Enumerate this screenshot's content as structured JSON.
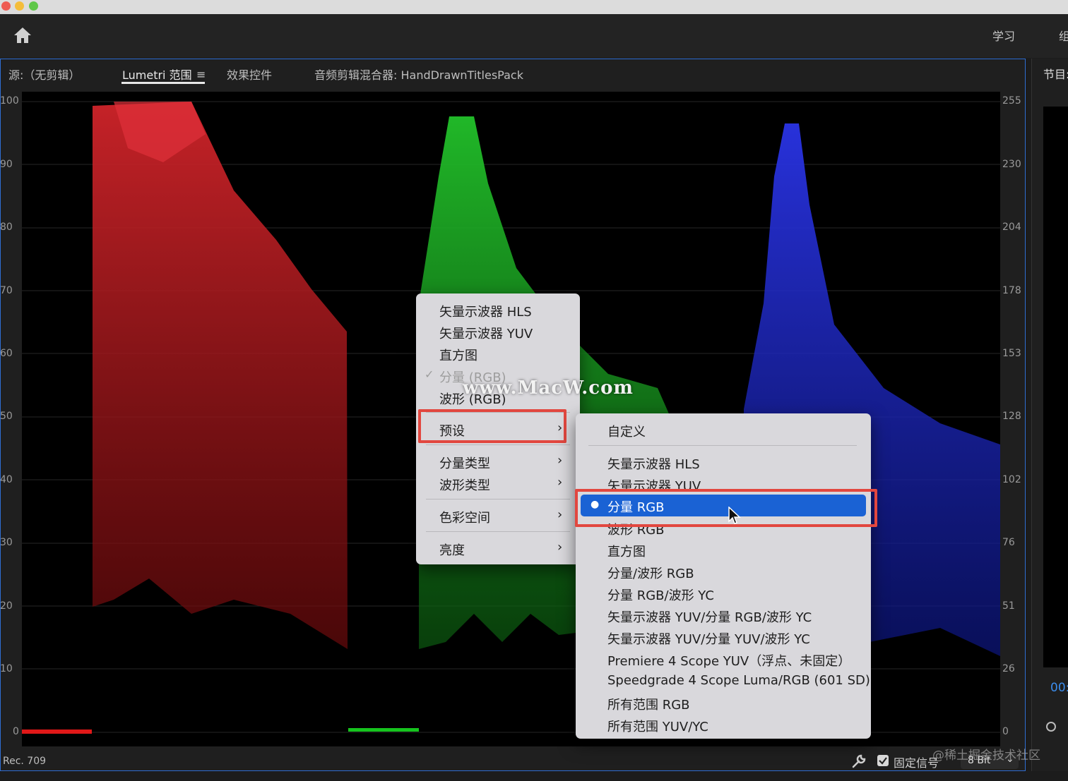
{
  "topbar": {
    "nav_learn": "学习",
    "nav_partial": "组"
  },
  "tabs": [
    {
      "label": "源:（无剪辑）"
    },
    {
      "label": "Lumetri 范围"
    },
    {
      "label": "效果控件"
    },
    {
      "label": "音频剪辑混合器: HandDrawnTitlesPack"
    }
  ],
  "right_panel": {
    "title_partial": "节目:",
    "timecode_partial": "00:"
  },
  "scope": {
    "left_axis": [
      "100",
      "90",
      "80",
      "70",
      "60",
      "50",
      "40",
      "30",
      "20",
      "10",
      "0"
    ],
    "right_axis": [
      "255",
      "230",
      "204",
      "178",
      "153",
      "128",
      "102",
      "76",
      "51",
      "26",
      "0"
    ]
  },
  "context_menu": {
    "items": [
      {
        "label": "矢量示波器 HLS"
      },
      {
        "label": "矢量示波器 YUV"
      },
      {
        "label": "直方图"
      },
      {
        "label": "分量 (RGB)",
        "checked": true,
        "disabled": true
      },
      {
        "label": "波形 (RGB)"
      },
      {
        "label": "预设"
      },
      {
        "label": "分量类型"
      },
      {
        "label": "波形类型"
      },
      {
        "label": "色彩空间"
      },
      {
        "label": "亮度"
      }
    ],
    "check_glyph": "✓",
    "chevron": "›"
  },
  "preset_menu": {
    "items": [
      {
        "label": "自定义"
      },
      {
        "label": "矢量示波器 HLS"
      },
      {
        "label": "矢量示波器 YUV"
      },
      {
        "label": "分量 RGB",
        "selected": true
      },
      {
        "label": "波形 RGB"
      },
      {
        "label": "直方图"
      },
      {
        "label": "分量/波形 RGB"
      },
      {
        "label": "分量 RGB/波形 YC"
      },
      {
        "label": "矢量示波器 YUV/分量 RGB/波形 YC"
      },
      {
        "label": "矢量示波器 YUV/分量 YUV/波形 YC"
      },
      {
        "label": "Premiere 4 Scope YUV（浮点、未固定）"
      },
      {
        "label": "Speedgrade 4 Scope Luma/RGB (601 SD)"
      },
      {
        "label": "所有范围 RGB"
      },
      {
        "label": "所有范围 YUV/YC"
      }
    ],
    "bullet": "●"
  },
  "watermark": "www.MacW.com",
  "statusbar": {
    "color_space": "Rec. 709",
    "clamp_label": "固定信号",
    "clamp_checked": true,
    "bit_depth": "8 Bit"
  },
  "attribution": "@稀土掘金技术社区",
  "colors": {
    "accent": "#1a62d4",
    "highlight_box": "#e2473f",
    "panel_border": "#2f6ed3"
  }
}
